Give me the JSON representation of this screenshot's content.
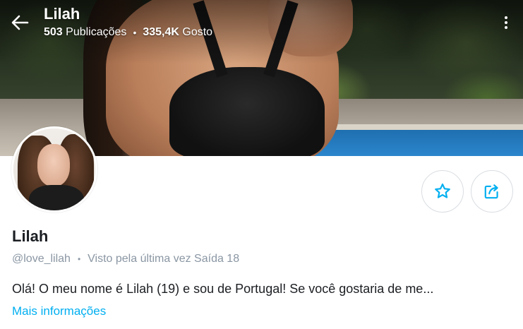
{
  "header": {
    "title": "Lilah",
    "posts_count": "503",
    "posts_label": "Publicações",
    "separator": "•",
    "likes_count": "335,4K",
    "likes_label": "Gosto",
    "back_icon": "arrow-left-icon",
    "menu_icon": "more-vertical-icon"
  },
  "profile": {
    "name": "Lilah",
    "username": "@love_lilah",
    "separator": "•",
    "last_seen": "Visto pela última vez Saída 18",
    "bio": "Olá! O meu nome é Lilah (19) e sou de Portugal! Se você gostaria de me...",
    "more_info": "Mais informações"
  },
  "actions": {
    "favorite_icon": "star-icon",
    "share_icon": "share-icon"
  },
  "colors": {
    "accent": "#00aff0",
    "text": "#1b1e22",
    "muted": "#8a96a3",
    "border": "#d9dde1"
  }
}
